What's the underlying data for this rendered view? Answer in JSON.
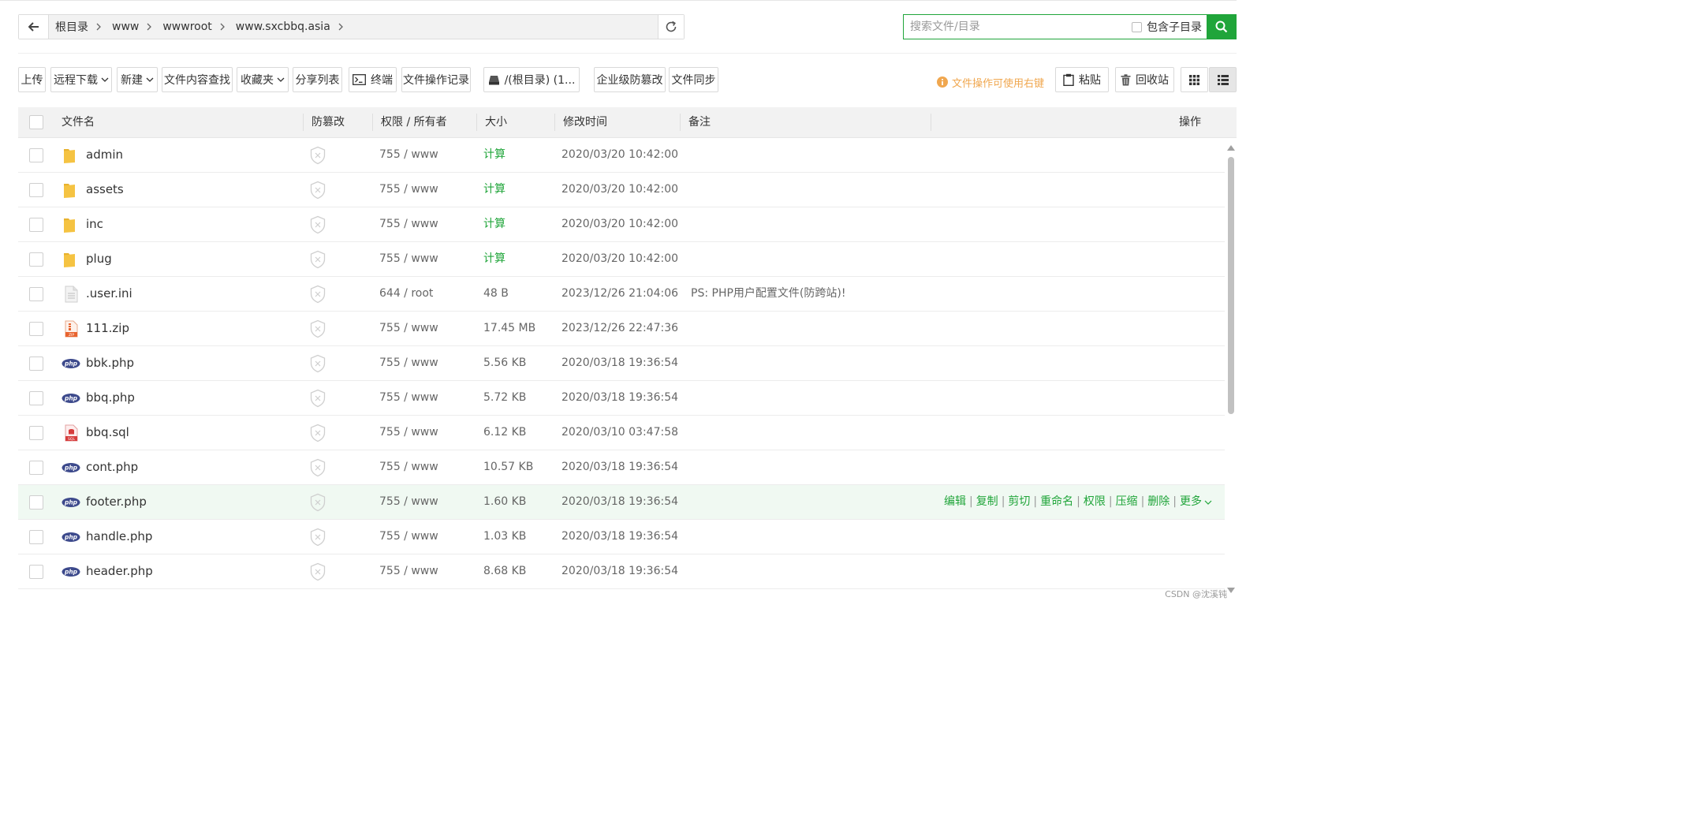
{
  "breadcrumb": [
    "根目录",
    "www",
    "wwwroot",
    "www.sxcbbq.asia"
  ],
  "search": {
    "placeholder": "搜索文件/目录",
    "subdir_label": "包含子目录"
  },
  "toolbar": {
    "upload": "上传",
    "remote_download": "远程下载",
    "new": "新建",
    "content_search": "文件内容查找",
    "favorites": "收藏夹",
    "share_list": "分享列表",
    "terminal": "终端",
    "op_log": "文件操作记录",
    "disk": "/(根目录) (1...",
    "tamper": "企业级防篡改",
    "sync": "文件同步",
    "tip": "文件操作可使用右键",
    "paste": "粘贴",
    "recycle": "回收站"
  },
  "columns": {
    "name": "文件名",
    "tamper": "防篡改",
    "perm": "权限 / 所有者",
    "size": "大小",
    "mtime": "修改时间",
    "note": "备注",
    "ops": "操作"
  },
  "files": [
    {
      "name": "admin",
      "type": "folder",
      "perm": "755 / www",
      "size": "计算",
      "mtime": "2020/03/20 10:42:00",
      "note": ""
    },
    {
      "name": "assets",
      "type": "folder",
      "perm": "755 / www",
      "size": "计算",
      "mtime": "2020/03/20 10:42:00",
      "note": ""
    },
    {
      "name": "inc",
      "type": "folder",
      "perm": "755 / www",
      "size": "计算",
      "mtime": "2020/03/20 10:42:00",
      "note": ""
    },
    {
      "name": "plug",
      "type": "folder",
      "perm": "755 / www",
      "size": "计算",
      "mtime": "2020/03/20 10:42:00",
      "note": ""
    },
    {
      "name": ".user.ini",
      "type": "text",
      "perm": "644 / root",
      "size": "48 B",
      "mtime": "2023/12/26 21:04:06",
      "note": "PS: PHP用户配置文件(防跨站)!"
    },
    {
      "name": "111.zip",
      "type": "zip",
      "perm": "755 / www",
      "size": "17.45 MB",
      "mtime": "2023/12/26 22:47:36",
      "note": ""
    },
    {
      "name": "bbk.php",
      "type": "php",
      "perm": "755 / www",
      "size": "5.56 KB",
      "mtime": "2020/03/18 19:36:54",
      "note": ""
    },
    {
      "name": "bbq.php",
      "type": "php",
      "perm": "755 / www",
      "size": "5.72 KB",
      "mtime": "2020/03/18 19:36:54",
      "note": ""
    },
    {
      "name": "bbq.sql",
      "type": "sql",
      "perm": "755 / www",
      "size": "6.12 KB",
      "mtime": "2020/03/10 03:47:58",
      "note": ""
    },
    {
      "name": "cont.php",
      "type": "php",
      "perm": "755 / www",
      "size": "10.57 KB",
      "mtime": "2020/03/18 19:36:54",
      "note": ""
    },
    {
      "name": "footer.php",
      "type": "php",
      "perm": "755 / www",
      "size": "1.60 KB",
      "mtime": "2020/03/18 19:36:54",
      "note": "",
      "hovered": true
    },
    {
      "name": "handle.php",
      "type": "php",
      "perm": "755 / www",
      "size": "1.03 KB",
      "mtime": "2020/03/18 19:36:54",
      "note": ""
    },
    {
      "name": "header.php",
      "type": "php",
      "perm": "755 / www",
      "size": "8.68 KB",
      "mtime": "2020/03/18 19:36:54",
      "note": ""
    }
  ],
  "row_actions": [
    "编辑",
    "复制",
    "剪切",
    "重命名",
    "权限",
    "压缩",
    "删除",
    "更多"
  ],
  "php_icon_text": "php",
  "zip_icon_text": "ZIP",
  "sql_icon_text": "SQL",
  "watermark": "CSDN @沈溪钝",
  "colors": {
    "accent": "#20a53a",
    "tip": "#f0a74f",
    "php": "#3d4a8c",
    "folder": "#f5c342"
  }
}
